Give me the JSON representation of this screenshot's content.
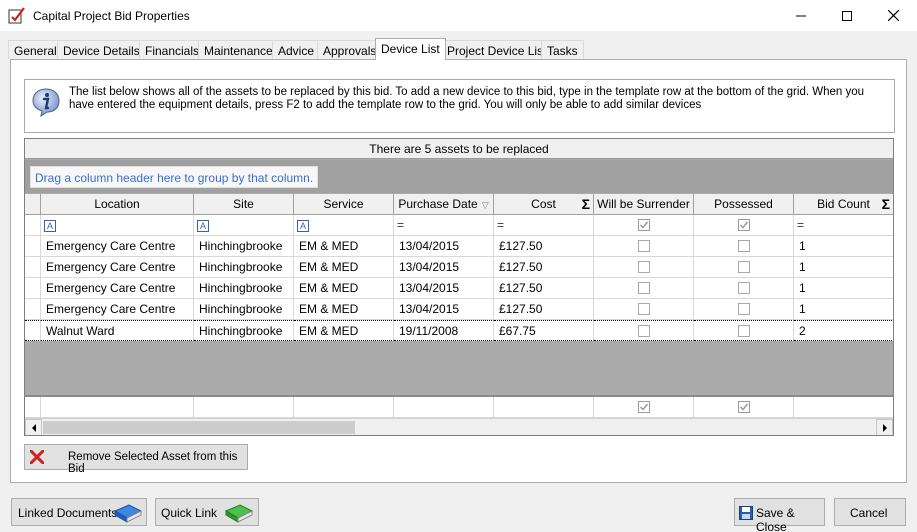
{
  "window": {
    "title": "Capital Project Bid Properties"
  },
  "tabs": [
    {
      "label": "General"
    },
    {
      "label": "Device Details"
    },
    {
      "label": "Financials"
    },
    {
      "label": "Maintenance"
    },
    {
      "label": "Advice"
    },
    {
      "label": "Approvals"
    },
    {
      "label": "Device List",
      "active": true
    },
    {
      "label": "Project Device List"
    },
    {
      "label": "Tasks"
    }
  ],
  "info": {
    "text": "The list below shows all of the assets to be replaced by this bid.  To add a new device to this bid, type in the template row at the bottom of the grid. When you have entered the equipment details, press F2 to add the template row to the grid. You will only be able to add similar devices"
  },
  "grid": {
    "caption": "There are 5 assets to be replaced",
    "group_hint": "Drag a column header here to group by that column.",
    "columns": [
      "Location",
      "Site",
      "Service",
      "Purchase Date",
      "Cost",
      "Will be Surrender",
      "Possessed",
      "Bid Count"
    ],
    "filter_row": {
      "text_filter_symbol": "A",
      "equals_symbol": "="
    },
    "rows": [
      {
        "location": "Emergency Care Centre",
        "site": "Hinchingbrooke",
        "service": "EM & MED",
        "purchase_date": "13/04/2015",
        "cost": "£127.50",
        "will_be_surrender": false,
        "possessed": false,
        "bid_count": "1"
      },
      {
        "location": "Emergency Care Centre",
        "site": "Hinchingbrooke",
        "service": "EM & MED",
        "purchase_date": "13/04/2015",
        "cost": "£127.50",
        "will_be_surrender": false,
        "possessed": false,
        "bid_count": "1"
      },
      {
        "location": "Emergency Care Centre",
        "site": "Hinchingbrooke",
        "service": "EM & MED",
        "purchase_date": "13/04/2015",
        "cost": "£127.50",
        "will_be_surrender": false,
        "possessed": false,
        "bid_count": "1"
      },
      {
        "location": "Emergency Care Centre",
        "site": "Hinchingbrooke",
        "service": "EM & MED",
        "purchase_date": "13/04/2015",
        "cost": "£127.50",
        "will_be_surrender": false,
        "possessed": false,
        "bid_count": "1"
      },
      {
        "location": "Walnut Ward",
        "site": "Hinchingbrooke",
        "service": "EM & MED",
        "purchase_date": "19/11/2008",
        "cost": "£67.75",
        "will_be_surrender": false,
        "possessed": false,
        "bid_count": "2",
        "selected": true
      }
    ]
  },
  "buttons": {
    "remove_asset": "Remove Selected Asset from this Bid",
    "linked_documents": "Linked Documents",
    "quick_link": "Quick Link",
    "save_close": "Save & Close",
    "cancel": "Cancel"
  },
  "colors": {
    "link_blue": "#3a6fcf",
    "book_blue": "#1f5fbf",
    "book_green": "#2e9a2e",
    "remove_red": "#d02020"
  },
  "icons": {
    "app": "checklist-icon",
    "info": "info-icon",
    "remove": "red-x-icon",
    "linked_documents": "blue-book-icon",
    "quick_link": "green-book-icon",
    "save": "floppy-disk-icon"
  }
}
